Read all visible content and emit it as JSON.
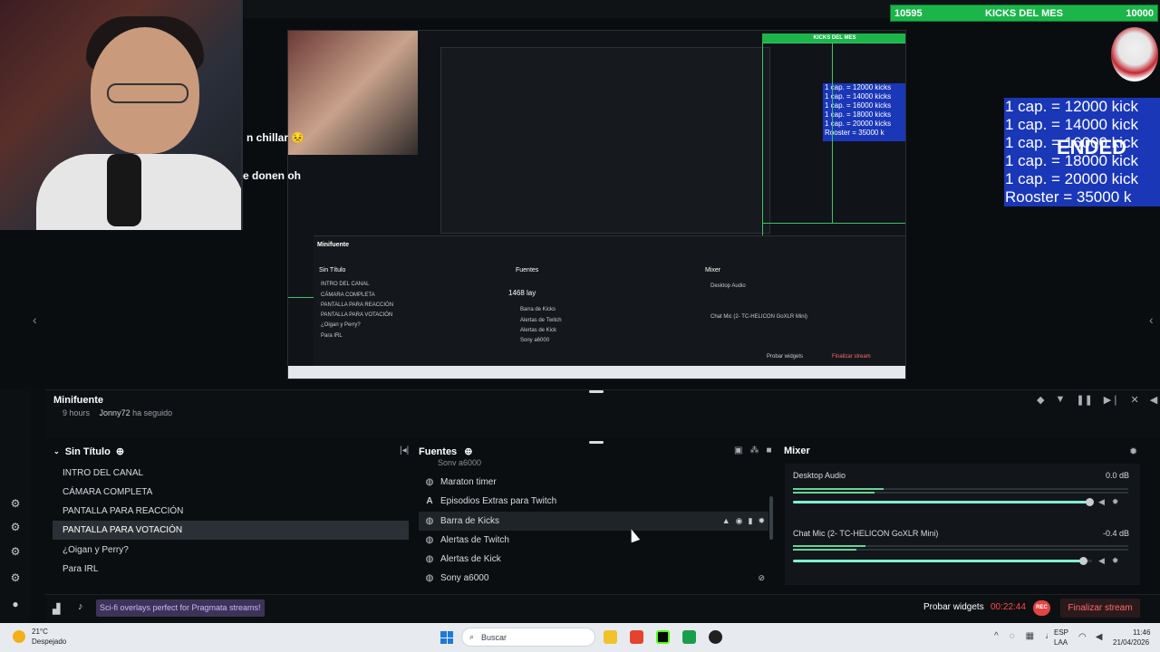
{
  "overlays": {
    "kicks_bar": {
      "left": "10595",
      "center": "KICKS DEL MES",
      "right": "10000"
    },
    "caps": [
      "1 cap. = 12000 kick",
      "1 cap. = 14000 kick",
      "1 cap. = 16000 kick",
      "1 cap. = 18000 kick",
      "1 cap. = 20000 kick",
      "Rooster = 35000 k"
    ],
    "caps_ended": "ENDED",
    "chat1": "n chillar 😣",
    "chat2": "e donen oh",
    "nested_counter": "1468 lay"
  },
  "minifuente": {
    "title": "Minifuente",
    "row_time": "9 hours",
    "row_user": "Jonny72",
    "row_text": "ha seguido"
  },
  "scenes": {
    "title": "Sin Título",
    "items": [
      {
        "label": "INTRO DEL CANAL"
      },
      {
        "label": "CÁMARA COMPLETA"
      },
      {
        "label": "PANTALLA PARA REACCIÓN"
      },
      {
        "label": "PANTALLA PARA VOTACIÓN"
      },
      {
        "label": "¿Oigan y Perry?"
      },
      {
        "label": "Para IRL"
      }
    ]
  },
  "sources": {
    "title": "Fuentes",
    "items": [
      {
        "label": "Maraton timer",
        "icon": "globe-icon"
      },
      {
        "label": "Episodios Extras para Twitch",
        "icon": "text-icon"
      },
      {
        "label": "Barra de Kicks",
        "icon": "globe-icon"
      },
      {
        "label": "Alertas de Twitch",
        "icon": "globe-icon"
      },
      {
        "label": "Alertas de Kick",
        "icon": "globe-icon"
      },
      {
        "label": "Sony a6000",
        "icon": "globe-icon"
      }
    ],
    "partial_top": "Sony a6000"
  },
  "mixer": {
    "title": "Mixer",
    "channels": [
      {
        "name": "Desktop Audio",
        "db": "0.0 dB",
        "level": 0.99
      },
      {
        "name": "Chat Mic (2- TC-HELICON GoXLR Mini)",
        "db": "-0.4 dB",
        "level": 0.97
      }
    ]
  },
  "bottom": {
    "promo": "Sci-fi overlays perfect for Pragmata streams!",
    "probar": "Probar widgets",
    "timer": "00:22:44",
    "rec": "REC",
    "finalizar": "Finalizar stream"
  },
  "taskbar": {
    "temp": "21°C",
    "weather": "Despejado",
    "search": "Buscar",
    "lang1": "ESP",
    "lang2": "LAA",
    "time": "11:46",
    "date": "21/04/2026"
  },
  "colors": {
    "accent_green": "#1bb54a",
    "caps_blue": "#1a37b8",
    "meter_green": "#68d39a",
    "volume_teal": "#80f5d2",
    "rec_red": "#e24545"
  }
}
